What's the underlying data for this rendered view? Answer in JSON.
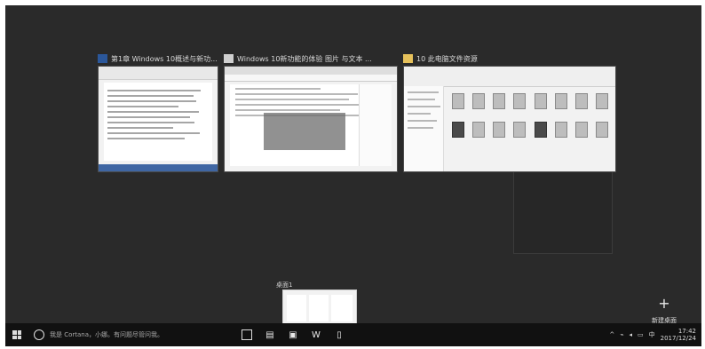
{
  "windows": [
    {
      "title": "第1章 Windows 10概述与新功...",
      "app": "word"
    },
    {
      "title": "Windows 10新功能的体验 图片 与文本 ...",
      "app": "browser"
    },
    {
      "title": "10 此电脑文件资源",
      "app": "explorer"
    }
  ],
  "virtual_desktops": {
    "label": "桌面1",
    "new_desktop_label": "新建桌面",
    "new_desktop_glyph": "+"
  },
  "taskbar": {
    "search_text": "我是 Cortana，小娜。有问题尽管问我。",
    "pinned_icons": [
      "task-view-icon",
      "folder-icon",
      "store-icon",
      "word-icon",
      "document-icon"
    ],
    "time": "17:42",
    "date": "2017/12/24",
    "tray": [
      "^",
      "network",
      "volume",
      "notifications",
      "中"
    ]
  }
}
